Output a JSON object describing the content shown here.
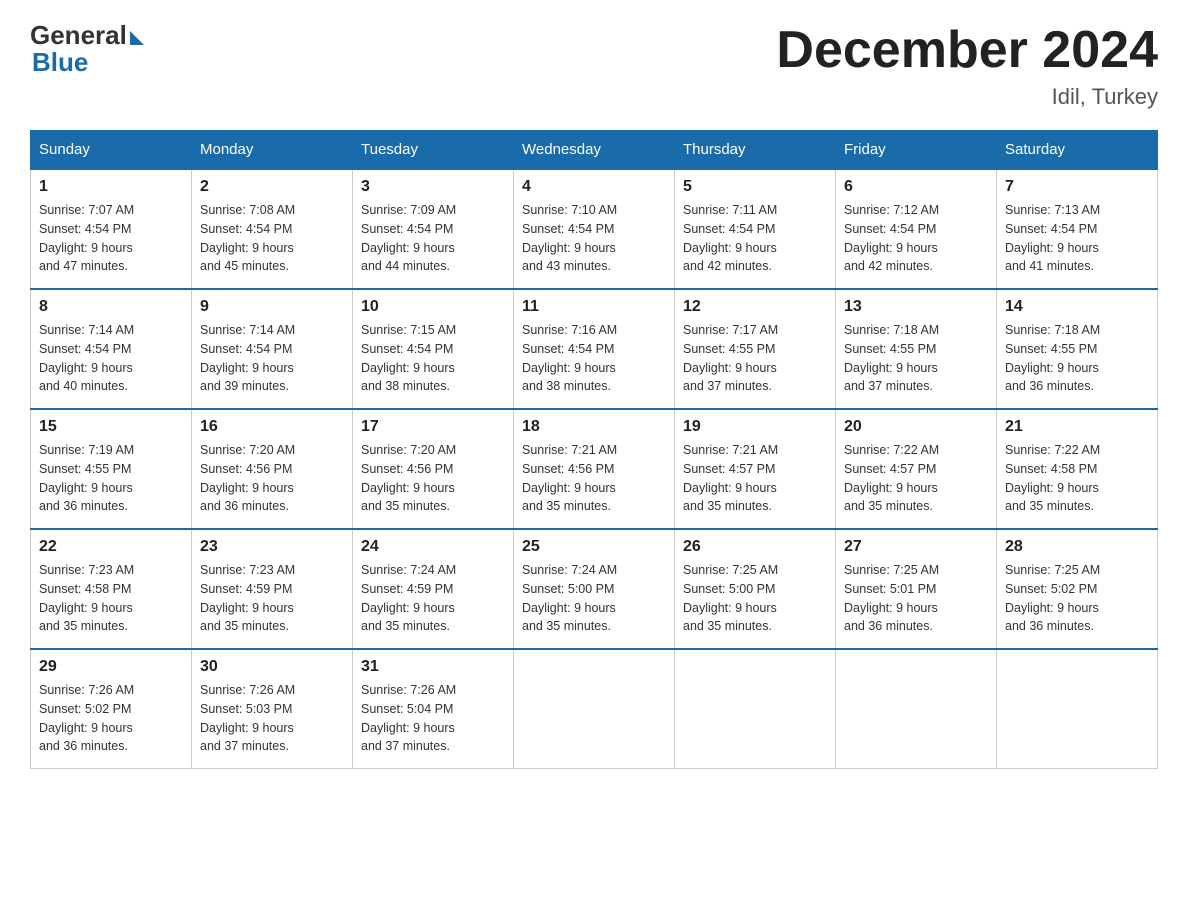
{
  "header": {
    "logo_general": "General",
    "logo_blue": "Blue",
    "month_title": "December 2024",
    "location": "Idil, Turkey"
  },
  "weekdays": [
    "Sunday",
    "Monday",
    "Tuesday",
    "Wednesday",
    "Thursday",
    "Friday",
    "Saturday"
  ],
  "weeks": [
    [
      {
        "day": "1",
        "sunrise": "7:07 AM",
        "sunset": "4:54 PM",
        "daylight": "9 hours and 47 minutes."
      },
      {
        "day": "2",
        "sunrise": "7:08 AM",
        "sunset": "4:54 PM",
        "daylight": "9 hours and 45 minutes."
      },
      {
        "day": "3",
        "sunrise": "7:09 AM",
        "sunset": "4:54 PM",
        "daylight": "9 hours and 44 minutes."
      },
      {
        "day": "4",
        "sunrise": "7:10 AM",
        "sunset": "4:54 PM",
        "daylight": "9 hours and 43 minutes."
      },
      {
        "day": "5",
        "sunrise": "7:11 AM",
        "sunset": "4:54 PM",
        "daylight": "9 hours and 42 minutes."
      },
      {
        "day": "6",
        "sunrise": "7:12 AM",
        "sunset": "4:54 PM",
        "daylight": "9 hours and 42 minutes."
      },
      {
        "day": "7",
        "sunrise": "7:13 AM",
        "sunset": "4:54 PM",
        "daylight": "9 hours and 41 minutes."
      }
    ],
    [
      {
        "day": "8",
        "sunrise": "7:14 AM",
        "sunset": "4:54 PM",
        "daylight": "9 hours and 40 minutes."
      },
      {
        "day": "9",
        "sunrise": "7:14 AM",
        "sunset": "4:54 PM",
        "daylight": "9 hours and 39 minutes."
      },
      {
        "day": "10",
        "sunrise": "7:15 AM",
        "sunset": "4:54 PM",
        "daylight": "9 hours and 38 minutes."
      },
      {
        "day": "11",
        "sunrise": "7:16 AM",
        "sunset": "4:54 PM",
        "daylight": "9 hours and 38 minutes."
      },
      {
        "day": "12",
        "sunrise": "7:17 AM",
        "sunset": "4:55 PM",
        "daylight": "9 hours and 37 minutes."
      },
      {
        "day": "13",
        "sunrise": "7:18 AM",
        "sunset": "4:55 PM",
        "daylight": "9 hours and 37 minutes."
      },
      {
        "day": "14",
        "sunrise": "7:18 AM",
        "sunset": "4:55 PM",
        "daylight": "9 hours and 36 minutes."
      }
    ],
    [
      {
        "day": "15",
        "sunrise": "7:19 AM",
        "sunset": "4:55 PM",
        "daylight": "9 hours and 36 minutes."
      },
      {
        "day": "16",
        "sunrise": "7:20 AM",
        "sunset": "4:56 PM",
        "daylight": "9 hours and 36 minutes."
      },
      {
        "day": "17",
        "sunrise": "7:20 AM",
        "sunset": "4:56 PM",
        "daylight": "9 hours and 35 minutes."
      },
      {
        "day": "18",
        "sunrise": "7:21 AM",
        "sunset": "4:56 PM",
        "daylight": "9 hours and 35 minutes."
      },
      {
        "day": "19",
        "sunrise": "7:21 AM",
        "sunset": "4:57 PM",
        "daylight": "9 hours and 35 minutes."
      },
      {
        "day": "20",
        "sunrise": "7:22 AM",
        "sunset": "4:57 PM",
        "daylight": "9 hours and 35 minutes."
      },
      {
        "day": "21",
        "sunrise": "7:22 AM",
        "sunset": "4:58 PM",
        "daylight": "9 hours and 35 minutes."
      }
    ],
    [
      {
        "day": "22",
        "sunrise": "7:23 AM",
        "sunset": "4:58 PM",
        "daylight": "9 hours and 35 minutes."
      },
      {
        "day": "23",
        "sunrise": "7:23 AM",
        "sunset": "4:59 PM",
        "daylight": "9 hours and 35 minutes."
      },
      {
        "day": "24",
        "sunrise": "7:24 AM",
        "sunset": "4:59 PM",
        "daylight": "9 hours and 35 minutes."
      },
      {
        "day": "25",
        "sunrise": "7:24 AM",
        "sunset": "5:00 PM",
        "daylight": "9 hours and 35 minutes."
      },
      {
        "day": "26",
        "sunrise": "7:25 AM",
        "sunset": "5:00 PM",
        "daylight": "9 hours and 35 minutes."
      },
      {
        "day": "27",
        "sunrise": "7:25 AM",
        "sunset": "5:01 PM",
        "daylight": "9 hours and 36 minutes."
      },
      {
        "day": "28",
        "sunrise": "7:25 AM",
        "sunset": "5:02 PM",
        "daylight": "9 hours and 36 minutes."
      }
    ],
    [
      {
        "day": "29",
        "sunrise": "7:26 AM",
        "sunset": "5:02 PM",
        "daylight": "9 hours and 36 minutes."
      },
      {
        "day": "30",
        "sunrise": "7:26 AM",
        "sunset": "5:03 PM",
        "daylight": "9 hours and 37 minutes."
      },
      {
        "day": "31",
        "sunrise": "7:26 AM",
        "sunset": "5:04 PM",
        "daylight": "9 hours and 37 minutes."
      },
      null,
      null,
      null,
      null
    ]
  ],
  "labels": {
    "sunrise": "Sunrise:",
    "sunset": "Sunset:",
    "daylight": "Daylight:"
  }
}
